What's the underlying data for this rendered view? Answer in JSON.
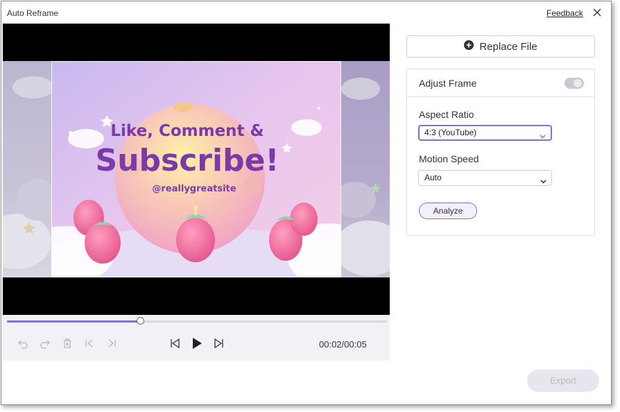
{
  "window": {
    "title": "Auto Reframe",
    "feedback_label": "Feedback"
  },
  "video": {
    "text_line1": "Like, Comment &",
    "text_line2": "Subscribe!",
    "handle": "@reallygreatsite",
    "progress": 0.35
  },
  "player": {
    "timecode": "00:02/00:05",
    "controls": [
      "undo-icon",
      "redo-icon",
      "delete-icon",
      "prev-keyframe-icon",
      "next-keyframe-icon",
      "skip-back-icon",
      "play-icon",
      "skip-forward-icon"
    ]
  },
  "panel": {
    "replace_label": "Replace File",
    "adjust_frame_label": "Adjust Frame",
    "adjust_frame_enabled": false,
    "aspect_ratio_label": "Aspect Ratio",
    "aspect_ratio_value": "4:3 (YouTube)",
    "motion_speed_label": "Motion Speed",
    "motion_speed_value": "Auto",
    "analyze_label": "Analyze"
  },
  "footer": {
    "export_label": "Export"
  },
  "colors": {
    "accent": "#8a6bd0",
    "title_text": "#7a3aa8"
  }
}
